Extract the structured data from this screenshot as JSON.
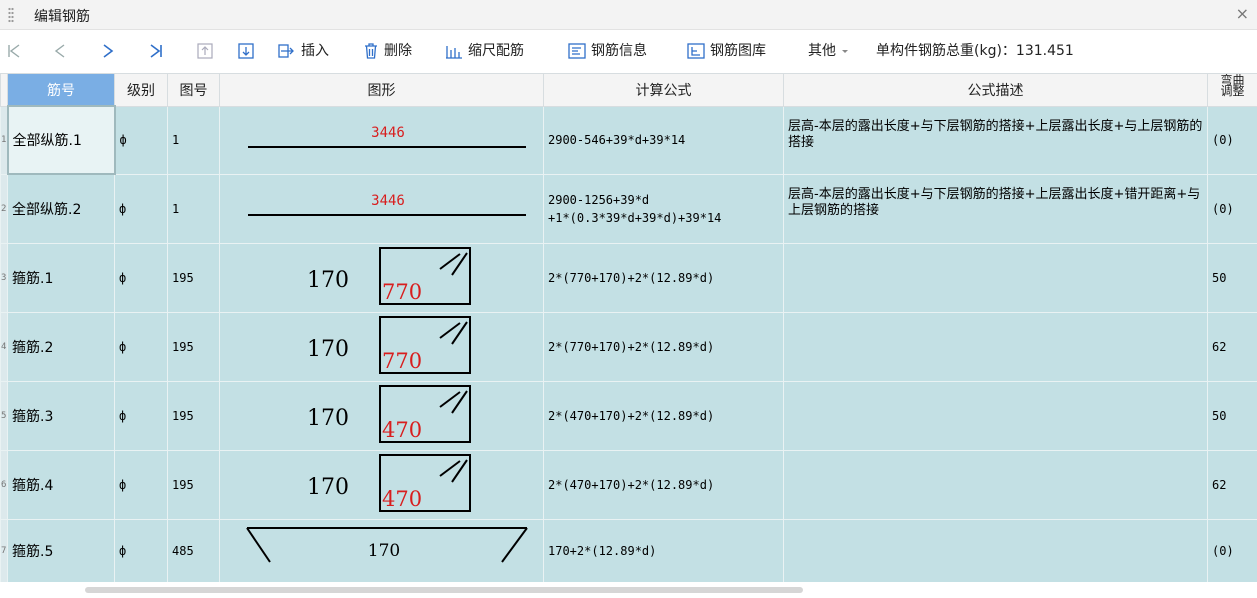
{
  "window": {
    "title": "编辑钢筋",
    "close_glyph": "×"
  },
  "toolbar": {
    "first": "|◁",
    "prev": "◁",
    "next": "▷",
    "last": "▷|",
    "insert": "插入",
    "delete": "删除",
    "scale": "缩尺配筋",
    "info": "钢筋信息",
    "library": "钢筋图库",
    "other": "其他",
    "weight_label": "单构件钢筋总重(kg)：131.451"
  },
  "table": {
    "headers": {
      "no": "筋号",
      "grade": "级别",
      "fig": "图号",
      "shape": "图形",
      "formula": "计算公式",
      "desc": "公式描述",
      "bend": "弯曲调整"
    },
    "rows": [
      {
        "idx": "1",
        "name": "全部纵筋.1",
        "grade": "ф",
        "fig": "1",
        "shape": {
          "type": "line",
          "label": "3446"
        },
        "formula": [
          "2900-546+39*d+39*14"
        ],
        "desc": "层高-本层的露出长度+与下层钢筋的搭接+上层露出长度+与上层钢筋的搭接",
        "bend": "(0)"
      },
      {
        "idx": "2",
        "name": "全部纵筋.2",
        "grade": "ф",
        "fig": "1",
        "shape": {
          "type": "line",
          "label": "3446"
        },
        "formula": [
          "2900-1256+39*d",
          "+1*(0.3*39*d+39*d)+39*14"
        ],
        "desc": "层高-本层的露出长度+与下层钢筋的搭接+上层露出长度+错开距离+与上层钢筋的搭接",
        "bend": "(0)"
      },
      {
        "idx": "3",
        "name": "箍筋.1",
        "grade": "ф",
        "fig": "195",
        "shape": {
          "type": "stirrup",
          "side": "170",
          "inner": "770"
        },
        "formula": [
          "2*(770+170)+2*(12.89*d)"
        ],
        "desc": "",
        "bend": "50"
      },
      {
        "idx": "4",
        "name": "箍筋.2",
        "grade": "ф",
        "fig": "195",
        "shape": {
          "type": "stirrup",
          "side": "170",
          "inner": "770"
        },
        "formula": [
          "2*(770+170)+2*(12.89*d)"
        ],
        "desc": "",
        "bend": "62"
      },
      {
        "idx": "5",
        "name": "箍筋.3",
        "grade": "ф",
        "fig": "195",
        "shape": {
          "type": "stirrup",
          "side": "170",
          "inner": "470"
        },
        "formula": [
          "2*(470+170)+2*(12.89*d)"
        ],
        "desc": "",
        "bend": "50"
      },
      {
        "idx": "6",
        "name": "箍筋.4",
        "grade": "ф",
        "fig": "195",
        "shape": {
          "type": "stirrup",
          "side": "170",
          "inner": "470"
        },
        "formula": [
          "2*(470+170)+2*(12.89*d)"
        ],
        "desc": "",
        "bend": "62"
      },
      {
        "idx": "7",
        "name": "箍筋.5",
        "grade": "ф",
        "fig": "485",
        "shape": {
          "type": "hook",
          "label": "170"
        },
        "formula": [
          "170+2*(12.89*d)"
        ],
        "desc": "",
        "bend": "(0)"
      }
    ]
  },
  "colors": {
    "row_bg": "#c3e0e4",
    "header_selected": "#7aaee4",
    "shape_label": "#d81e1e"
  }
}
